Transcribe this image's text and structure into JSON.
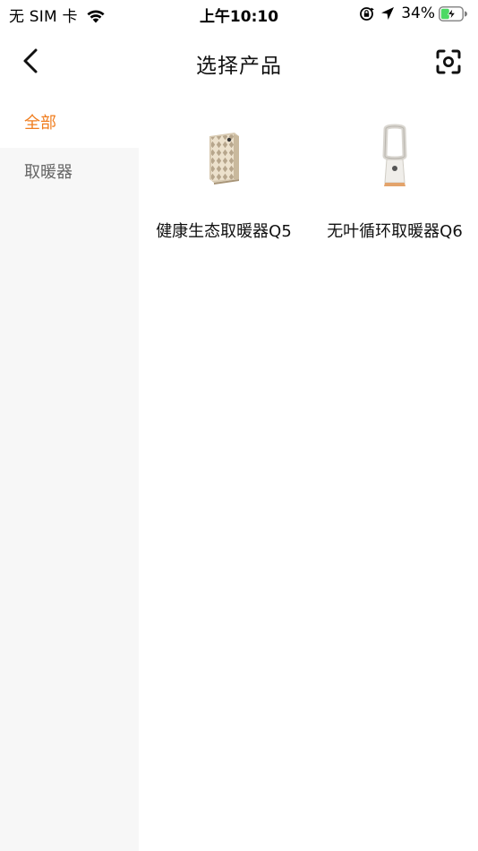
{
  "status_bar": {
    "carrier": "无 SIM 卡",
    "time": "上午10:10",
    "battery_percent": "34%",
    "battery_color": "#4cd964"
  },
  "header": {
    "title": "选择产品",
    "back_icon": "chevron-left-icon",
    "scan_icon": "scan-icon"
  },
  "sidebar": {
    "accent_color": "#f07d1e",
    "items": [
      {
        "label": "全部",
        "selected": true
      },
      {
        "label": "取暖器",
        "selected": false
      }
    ]
  },
  "products": [
    {
      "name": "健康生态取暖器Q5",
      "image": "panel-heater-image"
    },
    {
      "name": "无叶循环取暖器Q6",
      "image": "bladeless-heater-image"
    }
  ]
}
